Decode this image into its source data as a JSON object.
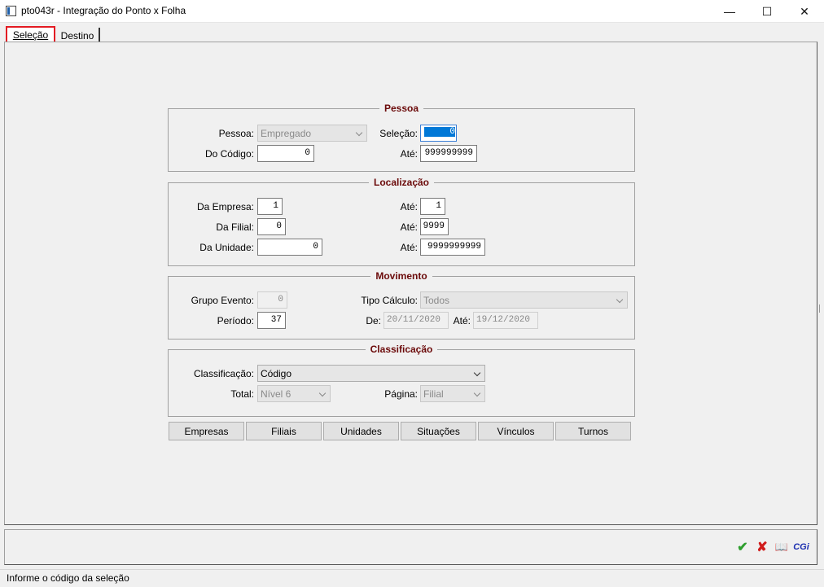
{
  "window": {
    "title": "pto043r - Integração do Ponto x Folha",
    "minimize_glyph": "—",
    "maximize_glyph": "☐",
    "close_glyph": "✕"
  },
  "tabs": [
    {
      "label": "Seleção",
      "active": true
    },
    {
      "label": "Destino",
      "active": false
    }
  ],
  "pessoa": {
    "title": "Pessoa",
    "pessoa_label": "Pessoa:",
    "pessoa_value": "Empregado",
    "selecao_label": "Seleção:",
    "selecao_value": "0",
    "do_codigo_label": "Do Código:",
    "do_codigo_value": "0",
    "ate_label": "Até:",
    "ate_value": "999999999"
  },
  "localizacao": {
    "title": "Localização",
    "da_empresa_label": "Da Empresa:",
    "da_empresa_value": "1",
    "ate_empresa_label": "Até:",
    "ate_empresa_value": "1",
    "da_filial_label": "Da Filial:",
    "da_filial_value": "0",
    "ate_filial_label": "Até:",
    "ate_filial_value": "9999",
    "da_unidade_label": "Da Unidade:",
    "da_unidade_value": "0",
    "ate_unidade_label": "Até:",
    "ate_unidade_value": "9999999999"
  },
  "movimento": {
    "title": "Movimento",
    "grupo_evento_label": "Grupo Evento:",
    "grupo_evento_value": "0",
    "tipo_calculo_label": "Tipo Cálculo:",
    "tipo_calculo_value": "Todos",
    "periodo_label": "Período:",
    "periodo_value": "37",
    "de_label": "De:",
    "de_value": "20/11/2020",
    "ate_label": "Até:",
    "ate_value": "19/12/2020"
  },
  "classificacao": {
    "title": "Classificação",
    "classificacao_label": "Classificação:",
    "classificacao_value": "Código",
    "total_label": "Total:",
    "total_value": "Nível 6",
    "pagina_label": "Página:",
    "pagina_value": "Filial"
  },
  "buttons": [
    "Empresas",
    "Filiais",
    "Unidades",
    "Situações",
    "Vínculos",
    "Turnos"
  ],
  "toolbar": {
    "confirm_glyph": "✔",
    "cancel_glyph": "✘",
    "help_glyph": "📖",
    "brand": "CGi",
    "colors": {
      "confirm": "#2e9e2e",
      "cancel": "#d01c1c",
      "brand": "#1c2fb0"
    }
  },
  "status": {
    "text": "Informe o código da seleção"
  }
}
